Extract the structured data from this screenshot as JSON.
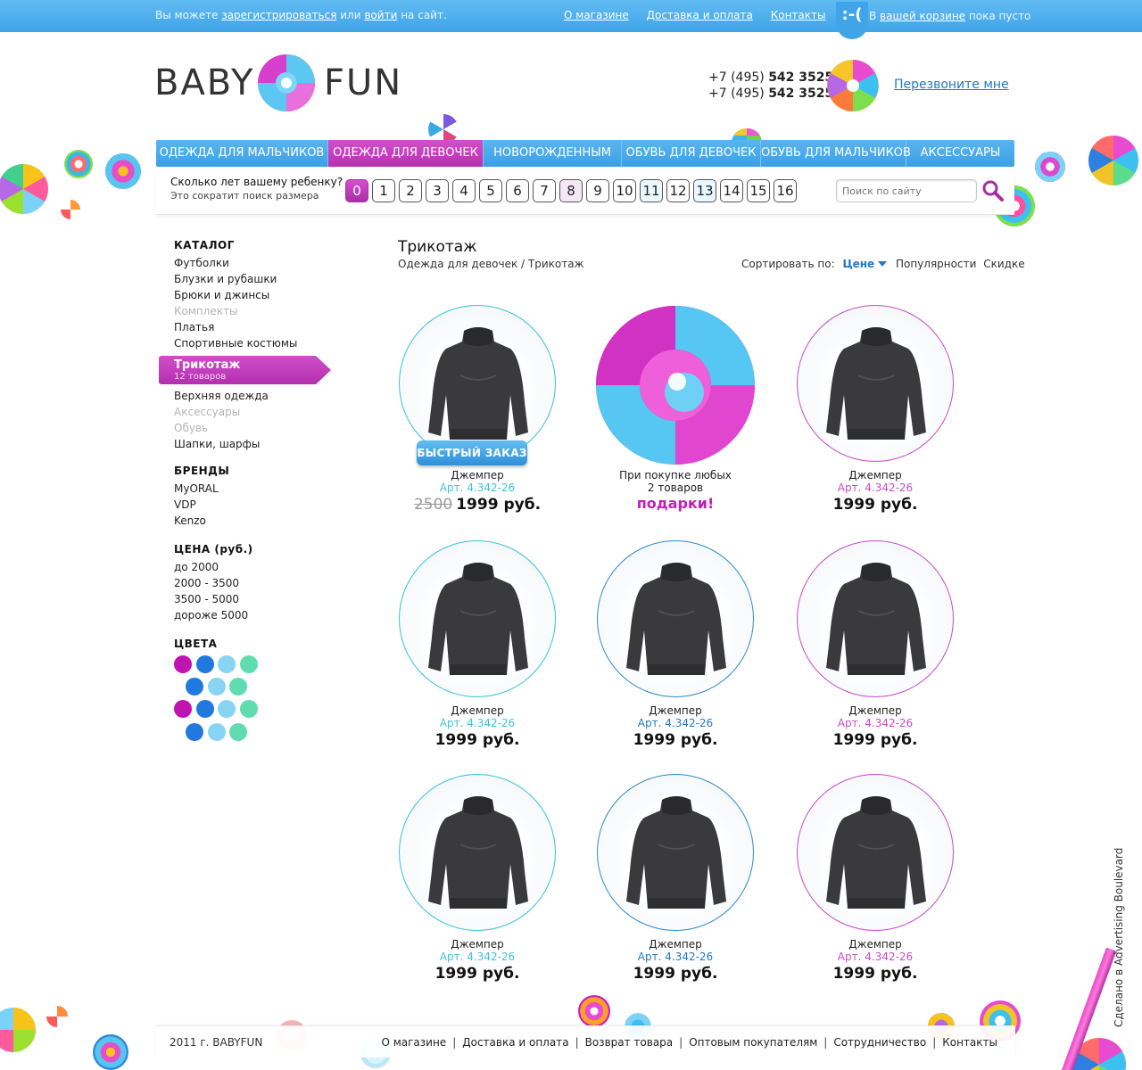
{
  "topbar": {
    "welcome_pre": "Вы можете",
    "register": "зарегистрироваться",
    "or": "или",
    "login": "войти",
    "welcome_post": "на сайт.",
    "nav": [
      "О магазине",
      "Доставка и оплата",
      "Контакты"
    ],
    "cart_face": ":-(",
    "cart_pre": "В",
    "cart_link": "вашей корзине",
    "cart_post": "пока пусто"
  },
  "header": {
    "logo_left": "BABY",
    "logo_right": "FUN",
    "phone1_pre": "+7 (495)",
    "phone1_num": "542 3525",
    "phone2_pre": "+7 (495)",
    "phone2_num": "542 3525",
    "callback": "Перезвоните мне"
  },
  "menu": {
    "items": [
      {
        "label": "ОДЕЖДА ДЛЯ МАЛЬЧИКОВ"
      },
      {
        "label": "ОДЕЖДА ДЛЯ ДЕВОЧЕК"
      },
      {
        "label": "НОВОРОЖДЕННЫМ"
      },
      {
        "label": "ОБУВЬ ДЛЯ ДЕВОЧЕК"
      },
      {
        "label": "ОБУВЬ ДЛЯ МАЛЬЧИКОВ"
      },
      {
        "label": "АКСЕССУАРЫ"
      }
    ]
  },
  "agebar": {
    "question": "Сколько лет вашему ребенку?",
    "sub": "Это сократит поиск размера",
    "ages": [
      "0",
      "1",
      "2",
      "3",
      "4",
      "5",
      "6",
      "7",
      "8",
      "9",
      "10",
      "11",
      "12",
      "13",
      "14",
      "15",
      "16"
    ],
    "search_placeholder": "Поиск по сайту"
  },
  "sidebar": {
    "catalog_title": "КАТАЛОГ",
    "catalog_before": [
      "Футболки",
      "Блузки и рубашки",
      "Брюки и джинсы",
      "Комплекты",
      "Платья",
      "Спортивные костюмы"
    ],
    "active_name": "Трикотаж",
    "active_count": "12 товаров",
    "catalog_after": [
      "Верхняя одежда",
      "Аксессуары",
      "Обувь",
      "Шапки, шарфы"
    ],
    "brands_title": "БРЕНДЫ",
    "brands": [
      "MyORAL",
      "VDP",
      "Kenzo"
    ],
    "price_title": "ЦЕНА (руб.)",
    "prices": [
      "до 2000",
      "2000 - 3500",
      "3500 - 5000",
      "дороже 5000"
    ],
    "colors_title": "ЦВЕТА"
  },
  "content": {
    "title": "Трикотаж",
    "breadcrumb": "Одежда для девочек / Трикотаж",
    "sort_label": "Сортировать по:",
    "sort_current": "Цене",
    "sort_options": [
      "Популярности",
      "Скидке"
    ],
    "quick_order": "БЫСТРЫЙ ЗАКАЗ",
    "promo_line1": "При покупке любых",
    "promo_line2": "2 товаров",
    "promo_gift": "подарки!",
    "products": [
      {
        "name": "Джемпер",
        "art": "Арт. 4.342-26",
        "old_price": "2500",
        "price": "1999 руб."
      },
      {
        "name": "Джемпер",
        "art": "Арт. 4.342-26",
        "price": "1999 руб."
      },
      {
        "name": "Джемпер",
        "art": "Арт. 4.342-26",
        "price": "1999 руб."
      },
      {
        "name": "Джемпер",
        "art": "Арт. 4.342-26",
        "price": "1999 руб."
      },
      {
        "name": "Джемпер",
        "art": "Арт. 4.342-26",
        "price": "1999 руб."
      },
      {
        "name": "Джемпер",
        "art": "Арт. 4.342-26",
        "price": "1999 руб."
      },
      {
        "name": "Джемпер",
        "art": "Арт. 4.342-26",
        "price": "1999 руб."
      },
      {
        "name": "Джемпер",
        "art": "Арт. 4.342-26",
        "price": "1999 руб."
      }
    ]
  },
  "footer": {
    "copyright": "2011 г. BABYFUN",
    "links": [
      "О магазине",
      "Доставка и оплата",
      "Возврат товара",
      "Оптовым покупателям",
      "Сотрудничество",
      "Контакты"
    ],
    "made_by": "Сделано в Advertising Boulevard"
  },
  "colors": {
    "topbar_blue": "#3fa4e8",
    "menu_pink": "#b431b0",
    "link_blue": "#1f79c8",
    "art_cyan": "#3cc3d9",
    "art_pink": "#c94acb",
    "gift_pink": "#c11fb8",
    "filter_colors": [
      "#c014b2",
      "#2179e0",
      "#88d4f5",
      "#5fdcb0"
    ]
  }
}
